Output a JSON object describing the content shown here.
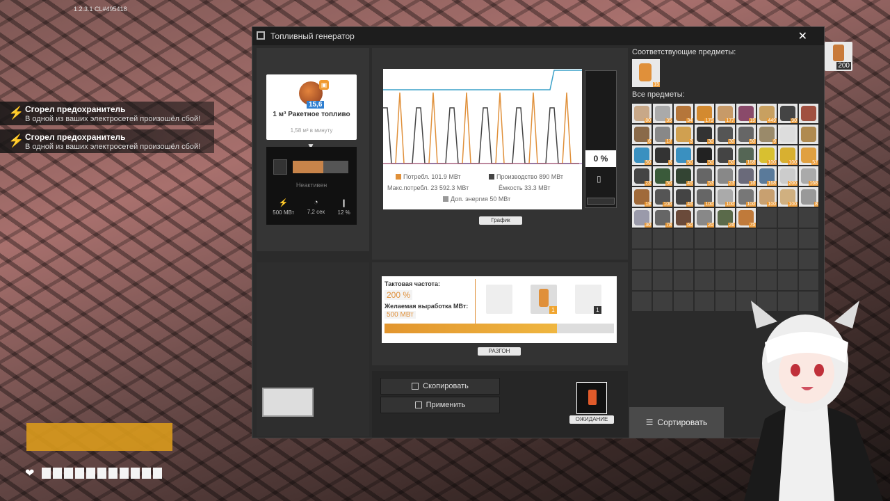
{
  "hud": {
    "version": "1.2.3.1 CL#495418",
    "notifications": [
      {
        "title": "Сгорел предохранитель",
        "desc": "В одной из ваших электросетей произошёл сбой!"
      },
      {
        "title": "Сгорел предохранитель",
        "desc": "В одной из ваших электросетей произошёл сбой!"
      }
    ]
  },
  "window": {
    "title": "Топливный генератор",
    "fuel": {
      "count": "15,6",
      "name": "1 м³ Ракетное топливо",
      "rate": "1,58 м³ в минуту"
    },
    "status": {
      "state": "Неактивен",
      "power": "500 МВт",
      "time": "7,2 сек",
      "productivity": "12 %",
      "progress": 0.55
    },
    "graph": {
      "consumption_label": "Потребл.",
      "consumption": "101.9 МВт",
      "production_label": "Производство",
      "production": "890 МВт",
      "max_consumption_label": "Макс.потребл.",
      "max_consumption": "23 592.3 МВт",
      "capacity_label": "Ёмкость",
      "capacity": "33.3 МВт",
      "extra_label": "Доп. энергия",
      "extra": "50 МВт",
      "tab": "График",
      "colors": {
        "consumption": "#e0903a",
        "production": "#444444",
        "max": "#3aa0c8",
        "extra": "#999999"
      }
    },
    "battery": {
      "percent": "0 %"
    },
    "overclock": {
      "clock_label": "Тактовая частота:",
      "clock_value": "200 %",
      "target_label": "Желаемая выработка МВт:",
      "target_value": "500 МВт",
      "tab": "РАЗГОН",
      "shards": [
        "",
        "1",
        "1"
      ],
      "level": 0.75
    },
    "buttons": {
      "copy": "Скопировать",
      "apply": "Применить",
      "standby": "ОЖИДАНИЕ"
    },
    "inventory": {
      "matching_title": "Соответствующие предметы:",
      "matching_qty": "15",
      "all_title": "Все предметы:",
      "corner_qty": "200",
      "sort": "Сортировать",
      "items": [
        {
          "c": "#c8a888",
          "q": "80"
        },
        {
          "c": "#aaaaaa",
          "q": "35"
        },
        {
          "c": "#b5763a",
          "q": "34"
        },
        {
          "c": "#d38a30",
          "q": "179"
        },
        {
          "c": "#c79a68",
          "q": "177"
        },
        {
          "c": "#8a4a6a",
          "q": "15"
        },
        {
          "c": "#c8a060",
          "q": "449"
        },
        {
          "c": "#444444",
          "q": "90"
        },
        {
          "c": "#a05040",
          "q": ""
        },
        {
          "c": "#8a6a4a",
          "q": "6"
        },
        {
          "c": "#888888",
          "q": "17"
        },
        {
          "c": "#d0a050",
          "q": "3"
        },
        {
          "c": "#333333",
          "q": "30"
        },
        {
          "c": "#555555",
          "q": "30"
        },
        {
          "c": "#666666",
          "q": "50"
        },
        {
          "c": "#9a8a6a",
          "q": "9"
        },
        {
          "c": "#dddddd",
          "q": ""
        },
        {
          "c": "#b08a50",
          "q": ""
        },
        {
          "c": "#3a90c0",
          "q": "50"
        },
        {
          "c": "#333333",
          "q": "8"
        },
        {
          "c": "#3a90c0",
          "q": "50"
        },
        {
          "c": "#222222",
          "q": "50"
        },
        {
          "c": "#444444",
          "q": "50"
        },
        {
          "c": "#556655",
          "q": "168"
        },
        {
          "c": "#d8c030",
          "q": "100"
        },
        {
          "c": "#d8b030",
          "q": "100"
        },
        {
          "c": "#e0a040",
          "q": "57"
        },
        {
          "c": "#444444",
          "q": "23"
        },
        {
          "c": "#3a5a3a",
          "q": "50"
        },
        {
          "c": "#334433",
          "q": "45"
        },
        {
          "c": "#666666",
          "q": "53"
        },
        {
          "c": "#888888",
          "q": "23"
        },
        {
          "c": "#6a6a7a",
          "q": "16"
        },
        {
          "c": "#5a7a9a",
          "q": "168"
        },
        {
          "c": "#cccccc",
          "q": "200"
        },
        {
          "c": "#aaaaaa",
          "q": "168"
        },
        {
          "c": "#a06a3a",
          "q": "19"
        },
        {
          "c": "#555555",
          "q": "100"
        },
        {
          "c": "#444444",
          "q": "45"
        },
        {
          "c": "#666666",
          "q": "100"
        },
        {
          "c": "#aaaaaa",
          "q": "100"
        },
        {
          "c": "#777777",
          "q": "100"
        },
        {
          "c": "#c8a070",
          "q": "100"
        },
        {
          "c": "#d0b080",
          "q": "100"
        },
        {
          "c": "#999999",
          "q": "8"
        },
        {
          "c": "#9a9aaa",
          "q": "30"
        },
        {
          "c": "#666666",
          "q": "78"
        },
        {
          "c": "#6a4a3a",
          "q": "60"
        },
        {
          "c": "#888888",
          "q": "20"
        },
        {
          "c": "#5a6a4a",
          "q": "26"
        },
        {
          "c": "#c07a3a",
          "q": "75"
        }
      ]
    }
  }
}
